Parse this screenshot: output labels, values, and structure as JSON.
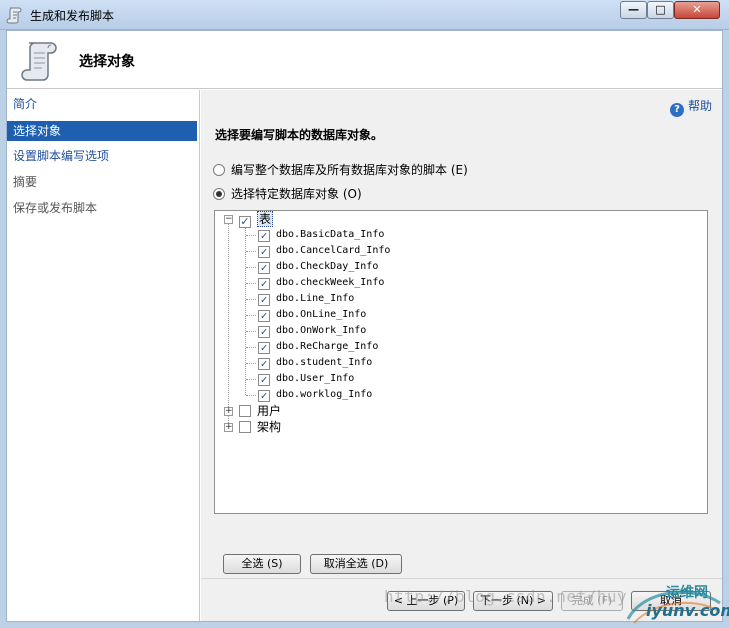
{
  "window": {
    "title": "生成和发布脚本",
    "minimize_glyph": "—",
    "maximize_glyph": "□",
    "close_glyph": "✕"
  },
  "header": {
    "title": "选择对象",
    "icon": "script-scroll-icon"
  },
  "nav": {
    "items": [
      {
        "label": "简介",
        "state": "link"
      },
      {
        "label": "选择对象",
        "state": "selected"
      },
      {
        "label": "设置脚本编写选项",
        "state": "link"
      },
      {
        "label": "摘要",
        "state": "disabled"
      },
      {
        "label": "保存或发布脚本",
        "state": "disabled"
      }
    ]
  },
  "main": {
    "help_label": "帮助",
    "help_icon": "help-icon",
    "prompt": "选择要编写脚本的数据库对象。",
    "radio_all": "编写整个数据库及所有数据库对象的脚本 (E)",
    "radio_specific": "选择特定数据库对象 (O)",
    "selected_radio": "specific",
    "tree": {
      "root_label": "表",
      "root_checked": true,
      "tables": [
        "dbo.BasicData_Info",
        "dbo.CancelCard_Info",
        "dbo.CheckDay_Info",
        "dbo.checkWeek_Info",
        "dbo.Line_Info",
        "dbo.OnLine_Info",
        "dbo.OnWork_Info",
        "dbo.ReCharge_Info",
        "dbo.student_Info",
        "dbo.User_Info",
        "dbo.worklog_Info"
      ],
      "other_nodes": [
        "用户",
        "架构"
      ]
    },
    "select_all": "全选 (S)",
    "deselect_all": "取消全选 (D)"
  },
  "footer": {
    "prev": "< 上一步 (P)",
    "next": "下一步 (N) >",
    "finish": "完成 (F)",
    "cancel": "取消"
  },
  "watermark": {
    "url": "http://blog.csdn.net/huy",
    "brand": "运维网",
    "domain": "iyunv.com"
  },
  "colors": {
    "nav_selected": "#1f5fb0",
    "link": "#1f4f9c",
    "panel_bg": "#f0f0f0"
  }
}
